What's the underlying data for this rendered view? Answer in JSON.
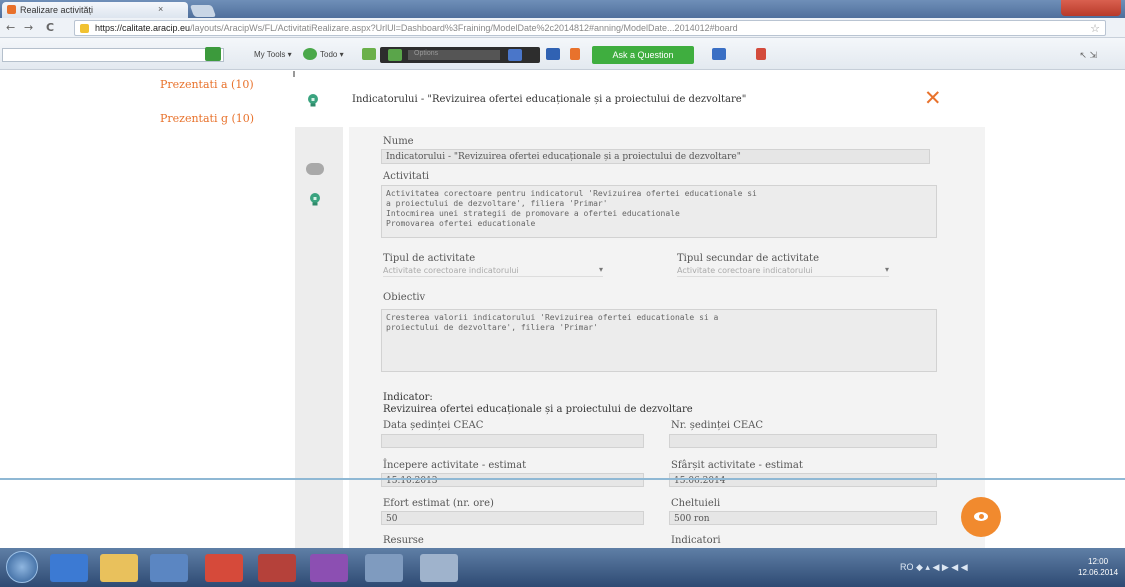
{
  "browser": {
    "tab_title": "Realizare activități",
    "tab_close": "×",
    "nav_back": "←",
    "nav_forward": "→",
    "nav_reload": "C",
    "url_host": "https://calitate.aracip.eu",
    "url_path": "/layouts/AracipWs/FL/ActivitatiRealizare.aspx?UrlUl=Dashboard%3Fraining/ModelDate%2c2014812#anning/ModelDate...2014012#board",
    "star": "☆"
  },
  "toolbar": {
    "my_tools": "My Tools ▾",
    "todo": "Todo ▾",
    "search_placeholder": "Options",
    "ask_button": "Ask a Question",
    "right": "↖ ⇲"
  },
  "page": {
    "side_links": [
      "Prezentati a (10)",
      "Prezentati g (10)"
    ]
  },
  "modal": {
    "title": "Indicatorului - \"Revizuirea ofertei educaționale și a proiectului de dezvoltare\"",
    "close": "✕",
    "form": {
      "name_label": "Nume",
      "name_value": "Indicatorului - \"Revizuirea ofertei educaționale și a proiectului de dezvoltare\"",
      "activities_label": "Activitati",
      "activities_lines": [
        "Activitatea corectoare pentru indicatorul 'Revizuirea ofertei educationale si",
        "a proiectului de dezvoltare', filiera 'Primar'",
        "Intocmirea unei strategii de promovare a ofertei educationale",
        "Promovarea ofertei educationale"
      ],
      "activity_type_label": "Tipul de activitate",
      "activity_type_value": "Activitate corectoare indicatorului",
      "secondary_type_label": "Tipul secundar de activitate",
      "secondary_type_value": "Activitate corectoare indicatorului",
      "objective_label": "Obiectiv",
      "objective_lines": [
        "Cresterea valorii indicatorului 'Revizuirea ofertei educationale si a",
        "proiectului de dezvoltare', filiera 'Primar'"
      ],
      "indicator_label": "Indicator:",
      "indicator_value": "Revizuirea ofertei educaționale și a proiectului de dezvoltare",
      "ceac_date_label": "Data ședinței CEAC",
      "ceac_date_value": "",
      "ceac_nr_label": "Nr. ședinței CEAC",
      "ceac_nr_value": "",
      "start_label": "Începere activitate - estimat",
      "start_value": "15.10.2013",
      "end_label": "Sfârșit activitate - estimat",
      "end_value": "15.06.2014",
      "effort_label": "Efort estimat (nr. ore)",
      "effort_value": "50",
      "cost_label": "Cheltuieli",
      "cost_value": "500 ron",
      "more_left": "Resurse",
      "more_right": "Indicatori"
    }
  },
  "taskbar": {
    "tray": "RO ◆ ▴ ◀ ▶ ◀ ◀",
    "clock_time": "12:00",
    "clock_date": "12.06.2014"
  },
  "colors": {
    "accent": "#e8722c",
    "fab": "#f18a2e",
    "ask": "#3fae3f",
    "rule": "#8fb8d4"
  }
}
